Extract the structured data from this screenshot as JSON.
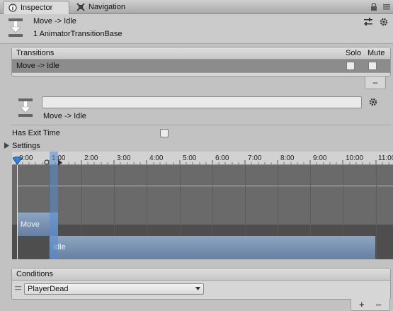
{
  "tabs": [
    {
      "label": "Inspector",
      "icon": "inspector-icon",
      "active": true
    },
    {
      "label": "Navigation",
      "icon": "navigation-icon",
      "active": false
    }
  ],
  "header": {
    "title": "Move -> Idle",
    "subtitle": "1 AnimatorTransitionBase",
    "icons": [
      "transition-icon",
      "preset-icon",
      "settings-gear-icon"
    ]
  },
  "transitions_panel": {
    "heading": "Transitions",
    "col_solo": "Solo",
    "col_mute": "Mute",
    "rows": [
      {
        "name": "Move -> Idle",
        "solo": false,
        "mute": false
      }
    ],
    "remove_button": "–"
  },
  "transition_detail": {
    "name_field_value": "",
    "name": "Move -> Idle",
    "has_exit_time_label": "Has Exit Time",
    "has_exit_time": false,
    "settings_label": "Settings"
  },
  "timeline": {
    "ticks": [
      "0:00",
      "1:00",
      "2:00",
      "3:00",
      "4:00",
      "5:00",
      "6:00",
      "7:00",
      "8:00",
      "9:00",
      "10:00",
      "11:00"
    ],
    "states": [
      {
        "name": "Move"
      },
      {
        "name": "Idle"
      }
    ]
  },
  "conditions": {
    "heading": "Conditions",
    "parameter": "PlayerDead",
    "add_button": "+",
    "remove_button": "–"
  },
  "colors": {
    "panel_bg": "#c2c2c2",
    "selected_row": "#8c8c8c",
    "state_bar": "#7890b0",
    "blend_marker": "#4f86d6"
  }
}
